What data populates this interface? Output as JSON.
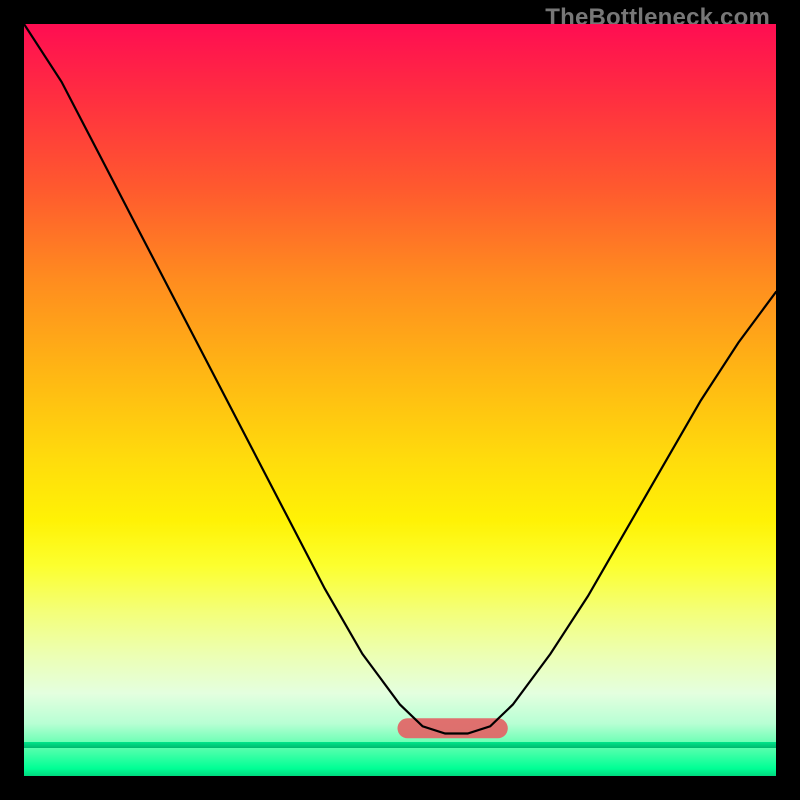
{
  "watermark": "TheBottleneck.com",
  "chart_data": {
    "type": "line",
    "title": "",
    "xlabel": "",
    "ylabel": "",
    "xlim": [
      0,
      100
    ],
    "ylim": [
      0,
      100
    ],
    "grid": false,
    "legend": false,
    "background": "red-yellow-green vertical gradient",
    "series": [
      {
        "name": "bottleneck-curve",
        "x": [
          0,
          5,
          10,
          15,
          20,
          25,
          30,
          35,
          40,
          45,
          50,
          53,
          56,
          59,
          62,
          65,
          70,
          75,
          80,
          85,
          90,
          95,
          100
        ],
        "y": [
          100,
          92,
          82,
          72,
          62,
          52,
          42,
          32,
          22,
          13,
          6,
          3,
          2,
          2,
          3,
          6,
          13,
          21,
          30,
          39,
          48,
          56,
          63
        ]
      }
    ],
    "annotations": [
      {
        "name": "optimal-range-marker",
        "type": "segment",
        "x": [
          51,
          63
        ],
        "y": [
          3,
          3
        ],
        "color": "#e06868"
      }
    ]
  }
}
